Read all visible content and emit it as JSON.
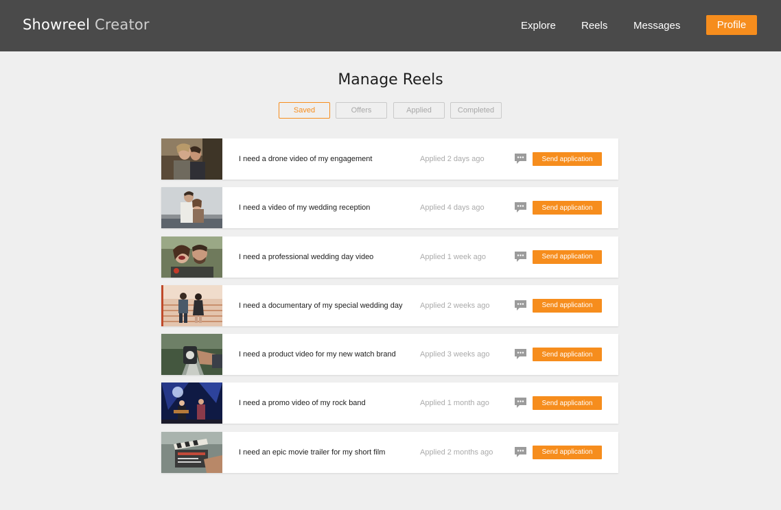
{
  "header": {
    "brand_main": "Showreel",
    "brand_sub": "Creator",
    "nav": [
      "Explore",
      "Reels",
      "Messages"
    ],
    "profile_label": "Profile"
  },
  "page": {
    "title": "Manage Reels"
  },
  "tabs": [
    {
      "label": "Saved",
      "active": true
    },
    {
      "label": "Offers",
      "active": false
    },
    {
      "label": "Applied",
      "active": false
    },
    {
      "label": "Completed",
      "active": false
    }
  ],
  "reels": [
    {
      "title": "I need a drone video of my engagement",
      "status": "Applied 2 days ago",
      "action": "Send application",
      "thumb": "couple-kissing-photo"
    },
    {
      "title": "I need a video of my wedding reception",
      "status": "Applied 4 days ago",
      "action": "Send application",
      "thumb": "couple-embracing-photo"
    },
    {
      "title": "I need a professional wedding day video",
      "status": "Applied 1 week ago",
      "action": "Send application",
      "thumb": "couple-laughing-photo"
    },
    {
      "title": "I need a documentary of my special wedding day",
      "status": "Applied 2 weeks ago",
      "action": "Send application",
      "thumb": "couple-walking-photo"
    },
    {
      "title": "I need a product video for my new watch brand",
      "status": "Applied 3 weeks ago",
      "action": "Send application",
      "thumb": "watch-photo"
    },
    {
      "title": "I need a promo video of my rock band",
      "status": "Applied 1 month ago",
      "action": "Send application",
      "thumb": "rock-band-photo"
    },
    {
      "title": "I need an epic movie trailer for my short film",
      "status": "Applied 2 months ago",
      "action": "Send application",
      "thumb": "clapperboard-photo"
    }
  ],
  "colors": {
    "accent": "#f68d1d",
    "header_bg": "#4a4a4a",
    "page_bg": "#efefef"
  }
}
